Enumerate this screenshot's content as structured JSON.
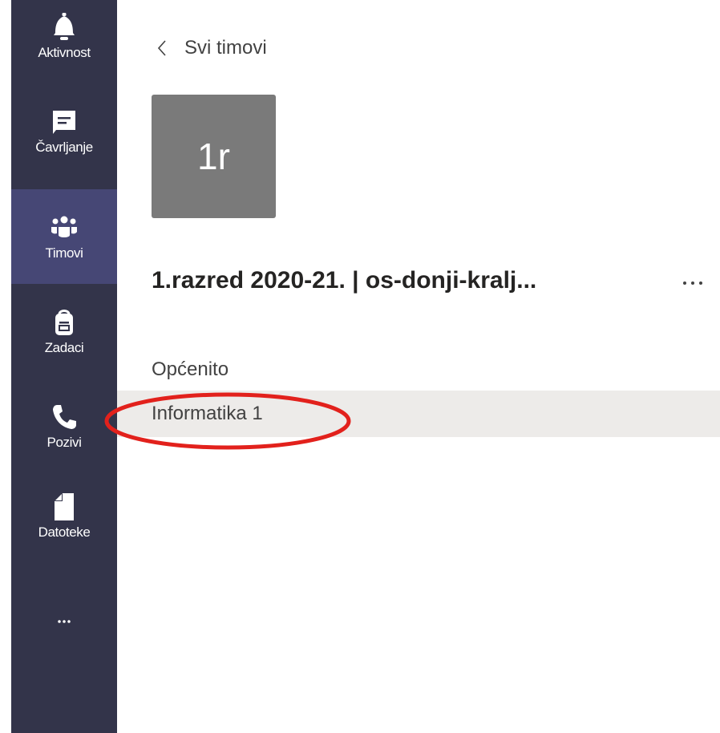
{
  "rail": {
    "items": [
      {
        "label": "Aktivnost",
        "icon": "bell-icon"
      },
      {
        "label": "Čavrljanje",
        "icon": "chat-icon"
      },
      {
        "label": "Timovi",
        "icon": "teams-icon",
        "active": true
      },
      {
        "label": "Zadaci",
        "icon": "assignments-icon"
      },
      {
        "label": "Pozivi",
        "icon": "phone-icon"
      },
      {
        "label": "Datoteke",
        "icon": "file-icon"
      }
    ],
    "more_icon": "ellipsis-icon"
  },
  "header": {
    "back_label": "Svi timovi",
    "back_icon": "chevron-left-icon"
  },
  "team": {
    "initials": "1r",
    "name": "1.razred 2020-21. | os-donji-kralj...",
    "more_icon": "more-horizontal-icon"
  },
  "channels": [
    {
      "label": "Općenito",
      "selected": false
    },
    {
      "label": "Informatika 1",
      "selected": true
    }
  ],
  "annotation": {
    "color": "#e2211c"
  },
  "colors": {
    "rail_bg": "#33344a",
    "rail_active": "#464775",
    "tile_bg": "#7a7a7a",
    "selected_row": "#edebe9"
  }
}
